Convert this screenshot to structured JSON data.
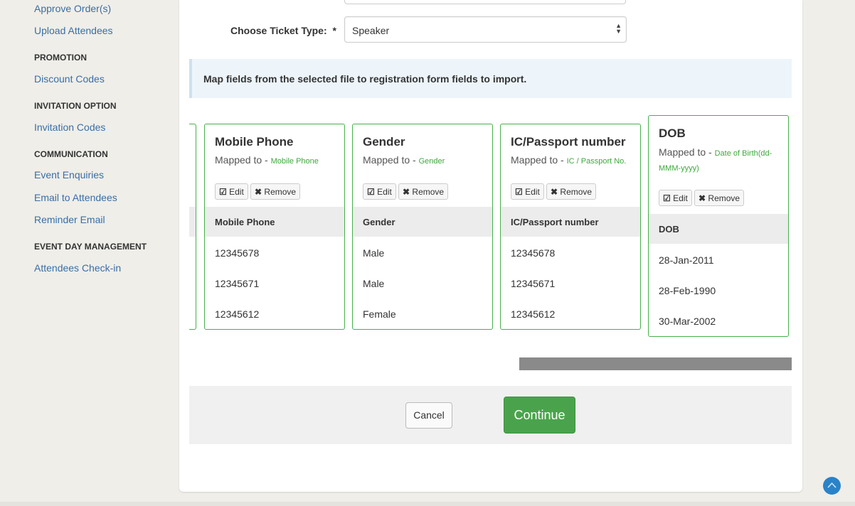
{
  "sidebar": {
    "approve_orders": "Approve Order(s)",
    "upload_attendees": "Upload Attendees",
    "promotion_heading": "PROMOTION",
    "discount_codes": "Discount Codes",
    "invitation_heading": "INVITATION OPTION",
    "invitation_codes": "Invitation Codes",
    "communication_heading": "COMMUNICATION",
    "event_enquiries": "Event Enquiries",
    "email_attendees": "Email to Attendees",
    "reminder_email": "Reminder Email",
    "event_day_heading": "EVENT DAY MANAGEMENT",
    "attendees_checkin": "Attendees Check-in"
  },
  "form": {
    "ticket_label": "Choose Ticket Type:",
    "required_mark": "*",
    "ticket_value": "Speaker",
    "info_text": "Map fields from the selected file to registration form fields to import."
  },
  "mapped_prefix": "Mapped to -",
  "edit_label": "Edit",
  "remove_label": "Remove",
  "cards": [
    {
      "title": "Mobile Phone",
      "mapped": "Mobile Phone",
      "header": "Mobile Phone",
      "rows": [
        "12345678",
        "12345671",
        "12345612"
      ]
    },
    {
      "title": "Gender",
      "mapped": "Gender",
      "header": "Gender",
      "rows": [
        "Male",
        "Male",
        "Female"
      ]
    },
    {
      "title": "IC/Passport number",
      "mapped": "IC / Passport No.",
      "header": "IC/Passport number",
      "rows": [
        "12345678",
        "12345671",
        "12345612"
      ]
    },
    {
      "title": "DOB",
      "mapped_line1": "Date of Birth(dd-",
      "mapped_line2": "MMM-yyyy)",
      "header": "DOB",
      "rows": [
        "28-Jan-2011",
        "28-Feb-1990",
        "30-Mar-2002"
      ]
    }
  ],
  "actions": {
    "cancel": "Cancel",
    "continue": "Continue"
  },
  "colors": {
    "link": "#3a6ea5",
    "card_border": "#46b04a",
    "mapped_value": "#3caa3c",
    "continue_bg": "#4aa34c",
    "scroll_top_bg": "#2a82c8"
  }
}
